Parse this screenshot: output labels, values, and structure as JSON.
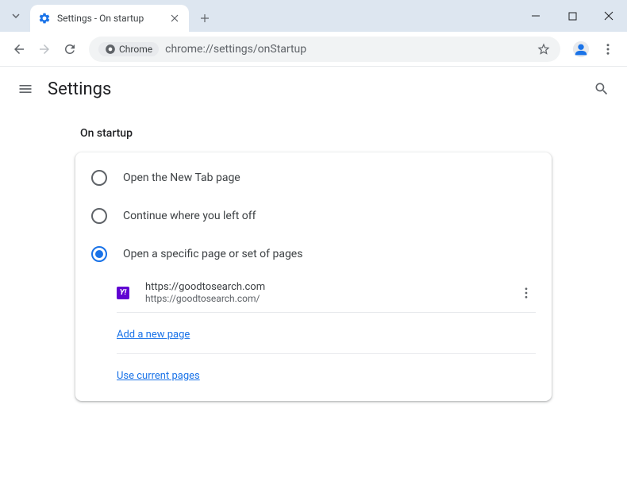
{
  "window": {
    "tab_title": "Settings - On startup"
  },
  "toolbar": {
    "chrome_chip": "Chrome",
    "url": "chrome://settings/onStartup"
  },
  "header": {
    "title": "Settings"
  },
  "section": {
    "title": "On startup"
  },
  "options": {
    "new_tab": "Open the New Tab page",
    "continue": "Continue where you left off",
    "specific": "Open a specific page or set of pages"
  },
  "page": {
    "title": "https://goodtosearch.com",
    "url": "https://goodtosearch.com/",
    "favicon_text": "Y!"
  },
  "links": {
    "add_page": "Add a new page",
    "use_current": "Use current pages"
  }
}
